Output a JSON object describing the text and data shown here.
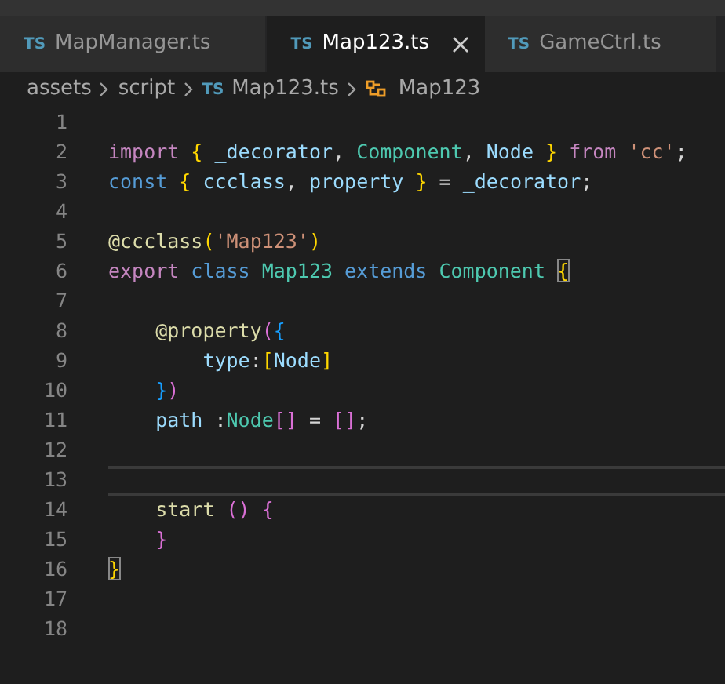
{
  "tabs": [
    {
      "icon_text": "TS",
      "label": "MapManager.ts",
      "selected": false
    },
    {
      "icon_text": "TS",
      "label": "Map123.ts",
      "selected": true
    },
    {
      "icon_text": "TS",
      "label": "GameCtrl.ts",
      "selected": false
    }
  ],
  "breadcrumb": [
    {
      "kind": "folder",
      "label": "assets"
    },
    {
      "kind": "folder",
      "label": "script"
    },
    {
      "kind": "file",
      "icon_text": "TS",
      "label": "Map123.ts"
    },
    {
      "kind": "class",
      "label": "Map123"
    }
  ],
  "lines": [
    {
      "number": "1",
      "current": false
    },
    {
      "number": "2",
      "current": false,
      "tokens": [
        {
          "kind": "keyword",
          "text": "import"
        },
        {
          "kind": "bracket1",
          "text": " {"
        },
        {
          "kind": "variable",
          "text": " _decorator"
        },
        {
          "kind": "plain",
          "text": ", "
        },
        {
          "kind": "type",
          "text": "Component"
        },
        {
          "kind": "plain",
          "text": ", "
        },
        {
          "kind": "variable",
          "text": "Node"
        },
        {
          "kind": "bracket1",
          "text": " }"
        },
        {
          "kind": "keyword",
          "text": " from"
        },
        {
          "kind": "string",
          "text": " 'cc'"
        },
        {
          "kind": "plain",
          "text": ";"
        }
      ]
    },
    {
      "number": "3",
      "current": false,
      "tokens": [
        {
          "kind": "storage",
          "text": "const"
        },
        {
          "kind": "bracket1",
          "text": " {"
        },
        {
          "kind": "variable",
          "text": " ccclass"
        },
        {
          "kind": "plain",
          "text": ", "
        },
        {
          "kind": "variable",
          "text": "property"
        },
        {
          "kind": "bracket1",
          "text": " }"
        },
        {
          "kind": "plain",
          "text": " = "
        },
        {
          "kind": "variable",
          "text": "_decorator"
        },
        {
          "kind": "plain",
          "text": ";"
        }
      ]
    },
    {
      "number": "4",
      "current": false
    },
    {
      "number": "5",
      "current": false,
      "tokens": [
        {
          "kind": "function",
          "text": "@ccclass"
        },
        {
          "kind": "bracket1",
          "text": "("
        },
        {
          "kind": "string",
          "text": "'Map123'"
        },
        {
          "kind": "bracket1",
          "text": ")"
        }
      ]
    },
    {
      "number": "6",
      "current": false,
      "tokens": [
        {
          "kind": "keyword",
          "text": "export"
        },
        {
          "kind": "storage",
          "text": " class"
        },
        {
          "kind": "type",
          "text": " Map123"
        },
        {
          "kind": "storage",
          "text": " extends"
        },
        {
          "kind": "type",
          "text": " Component "
        },
        {
          "kind": "matched",
          "text": "{"
        }
      ]
    },
    {
      "number": "7",
      "current": false
    },
    {
      "number": "8",
      "current": false,
      "tokens": [
        {
          "kind": "function",
          "text": "    @property"
        },
        {
          "kind": "bracket2",
          "text": "("
        },
        {
          "kind": "bracket3",
          "text": "{"
        }
      ]
    },
    {
      "number": "9",
      "current": false,
      "tokens": [
        {
          "kind": "variable",
          "text": "        type"
        },
        {
          "kind": "plain",
          "text": ":"
        },
        {
          "kind": "bracket1",
          "text": "["
        },
        {
          "kind": "variable",
          "text": "Node"
        },
        {
          "kind": "bracket1",
          "text": "]"
        }
      ]
    },
    {
      "number": "10",
      "current": false,
      "tokens": [
        {
          "kind": "bracket3",
          "text": "    }"
        },
        {
          "kind": "bracket2",
          "text": ")"
        }
      ]
    },
    {
      "number": "11",
      "current": false,
      "tokens": [
        {
          "kind": "variable",
          "text": "    path"
        },
        {
          "kind": "plain",
          "text": " :"
        },
        {
          "kind": "type",
          "text": "Node"
        },
        {
          "kind": "bracket2",
          "text": "[]"
        },
        {
          "kind": "plain",
          "text": " = "
        },
        {
          "kind": "bracket2",
          "text": "[]"
        },
        {
          "kind": "plain",
          "text": ";"
        }
      ]
    },
    {
      "number": "12",
      "current": false
    },
    {
      "number": "13",
      "current": true
    },
    {
      "number": "14",
      "current": false,
      "tokens": [
        {
          "kind": "function",
          "text": "    start"
        },
        {
          "kind": "bracket2",
          "text": " ()"
        },
        {
          "kind": "bracket2",
          "text": " {"
        }
      ]
    },
    {
      "number": "15",
      "current": false,
      "tokens": [
        {
          "kind": "bracket2",
          "text": "    }"
        }
      ]
    },
    {
      "number": "16",
      "current": false,
      "tokens": [
        {
          "kind": "matched",
          "text": "}"
        }
      ]
    },
    {
      "number": "17",
      "current": false
    },
    {
      "number": "18",
      "current": false
    }
  ]
}
